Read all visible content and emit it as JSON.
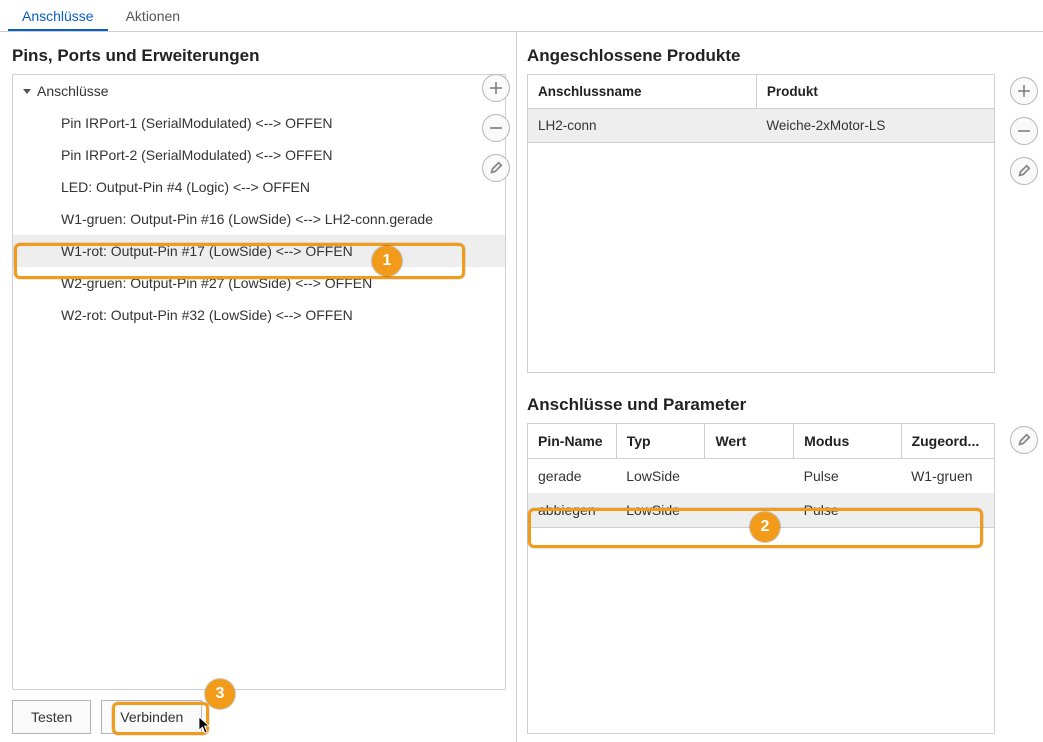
{
  "tabs": {
    "connections": "Anschlüsse",
    "actions": "Aktionen"
  },
  "leftPanel": {
    "title": "Pins, Ports und Erweiterungen",
    "tree": {
      "root": "Anschlüsse",
      "items": [
        "Pin IRPort-1 (SerialModulated) <--> OFFEN",
        "Pin IRPort-2 (SerialModulated) <--> OFFEN",
        "LED: Output-Pin #4 (Logic) <--> OFFEN",
        "W1-gruen: Output-Pin #16 (LowSide) <--> LH2-conn.gerade",
        "W1-rot: Output-Pin #17 (LowSide) <--> OFFEN",
        "W2-gruen: Output-Pin #27 (LowSide) <--> OFFEN",
        "W2-rot: Output-Pin #32 (LowSide) <--> OFFEN"
      ],
      "selected_index": 4
    },
    "buttons": {
      "test": "Testen",
      "connect": "Verbinden"
    }
  },
  "productsPanel": {
    "title": "Angeschlossene Produkte",
    "headers": {
      "name": "Anschlussname",
      "product": "Produkt"
    },
    "rows": [
      {
        "name": "LH2-conn",
        "product": "Weiche-2xMotor-LS"
      }
    ]
  },
  "paramsPanel": {
    "title": "Anschlüsse und Parameter",
    "headers": {
      "pin": "Pin-Name",
      "type": "Typ",
      "value": "Wert",
      "mode": "Modus",
      "assigned": "Zugeord..."
    },
    "rows": [
      {
        "pin": "gerade",
        "type": "LowSide",
        "value": "",
        "mode": "Pulse",
        "assigned": "W1-gruen"
      },
      {
        "pin": "abbiegen",
        "type": "LowSide",
        "value": "",
        "mode": "Pulse",
        "assigned": ""
      }
    ],
    "selected_index": 1
  },
  "annotations": {
    "b1": "1",
    "b2": "2",
    "b3": "3"
  }
}
